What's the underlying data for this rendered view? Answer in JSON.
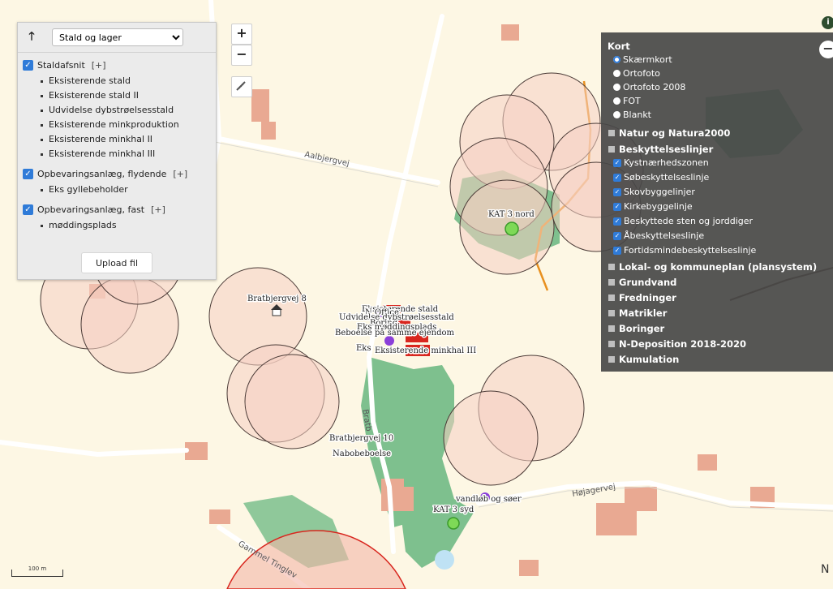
{
  "panel": {
    "up_icon": "🡑",
    "select_value": "Stald og lager",
    "groups": [
      {
        "label": "Staldafsnit",
        "expander": "[+]",
        "items": [
          "Eksisterende stald",
          "Eksisterende stald II",
          "Udvidelse dybstrøelsesstald",
          "Eksisterende minkproduktion",
          "Eksisterende minkhal II",
          "Eksisterende minkhal III"
        ]
      },
      {
        "label": "Opbevaringsanlæg, flydende",
        "expander": "[+]",
        "items": [
          "Eks gyllebeholder"
        ]
      },
      {
        "label": "Opbevaringsanlæg, fast",
        "expander": "[+]",
        "items": [
          "møddingsplads"
        ]
      }
    ],
    "upload_label": "Upload fil"
  },
  "zoom": {
    "in": "+",
    "out": "−"
  },
  "legend": {
    "title": "Kort",
    "basemaps": [
      {
        "label": "Skærmkort",
        "selected": true
      },
      {
        "label": "Ortofoto",
        "selected": false
      },
      {
        "label": "Ortofoto 2008",
        "selected": false
      },
      {
        "label": "FOT",
        "selected": false
      },
      {
        "label": "Blankt",
        "selected": false
      }
    ],
    "group_natur": "Natur og Natura2000",
    "group_beskyttelse": "Beskyttelseslinjer",
    "beskyttelse_items": [
      "Kystnærhedszonen",
      "Søbeskyttelseslinje",
      "Skovbyggelinjer",
      "Kirkebyggelinje",
      "Beskyttede sten og jorddiger",
      "Åbeskyttelseslinje",
      "Fortidsmindebeskyttelseslinje"
    ],
    "other_groups": [
      "Lokal- og kommuneplan (plansystem)",
      "Grundvand",
      "Fredninger",
      "Matrikler",
      "Boringer",
      "N-Deposition 2018-2020",
      "Kumulation"
    ],
    "collapse_icon": "−",
    "info_icon": "i"
  },
  "map": {
    "road_labels": [
      "Aalbjergvej",
      "Højagervej",
      "Gammel Tinglev",
      "Bratb"
    ],
    "labels": {
      "bratbjergvej8": "Bratbjergvej 8",
      "bratbjergvej10": "Bratbjergvej 10",
      "nabobeboelse": "Nabobeboelse",
      "kat3nord": "KAT 3 nord",
      "kat3syd": "KAT 3 syd",
      "vandlob": "vandløb og søer",
      "stald": "Eksisterende stald",
      "noffice": "N Office",
      "udvidelse": "Udvidelse dybstrøelsesstald",
      "boring": "Boring",
      "mod": "Eks møddingsplads",
      "beboelse": "Beboelse på samme ejendom",
      "eks": "Eks",
      "minkhal3": "Eksisterende minkhal III"
    },
    "scale": "100 m",
    "north": "N",
    "colors": {
      "buffer": "#f6cfc2",
      "forest": "#7ec08e",
      "building": "#e9a992",
      "road": "#ffffff",
      "stream": "#e8901f",
      "kat": "#7ed957",
      "purple": "#8b3fd9",
      "red": "#d8261e"
    }
  }
}
